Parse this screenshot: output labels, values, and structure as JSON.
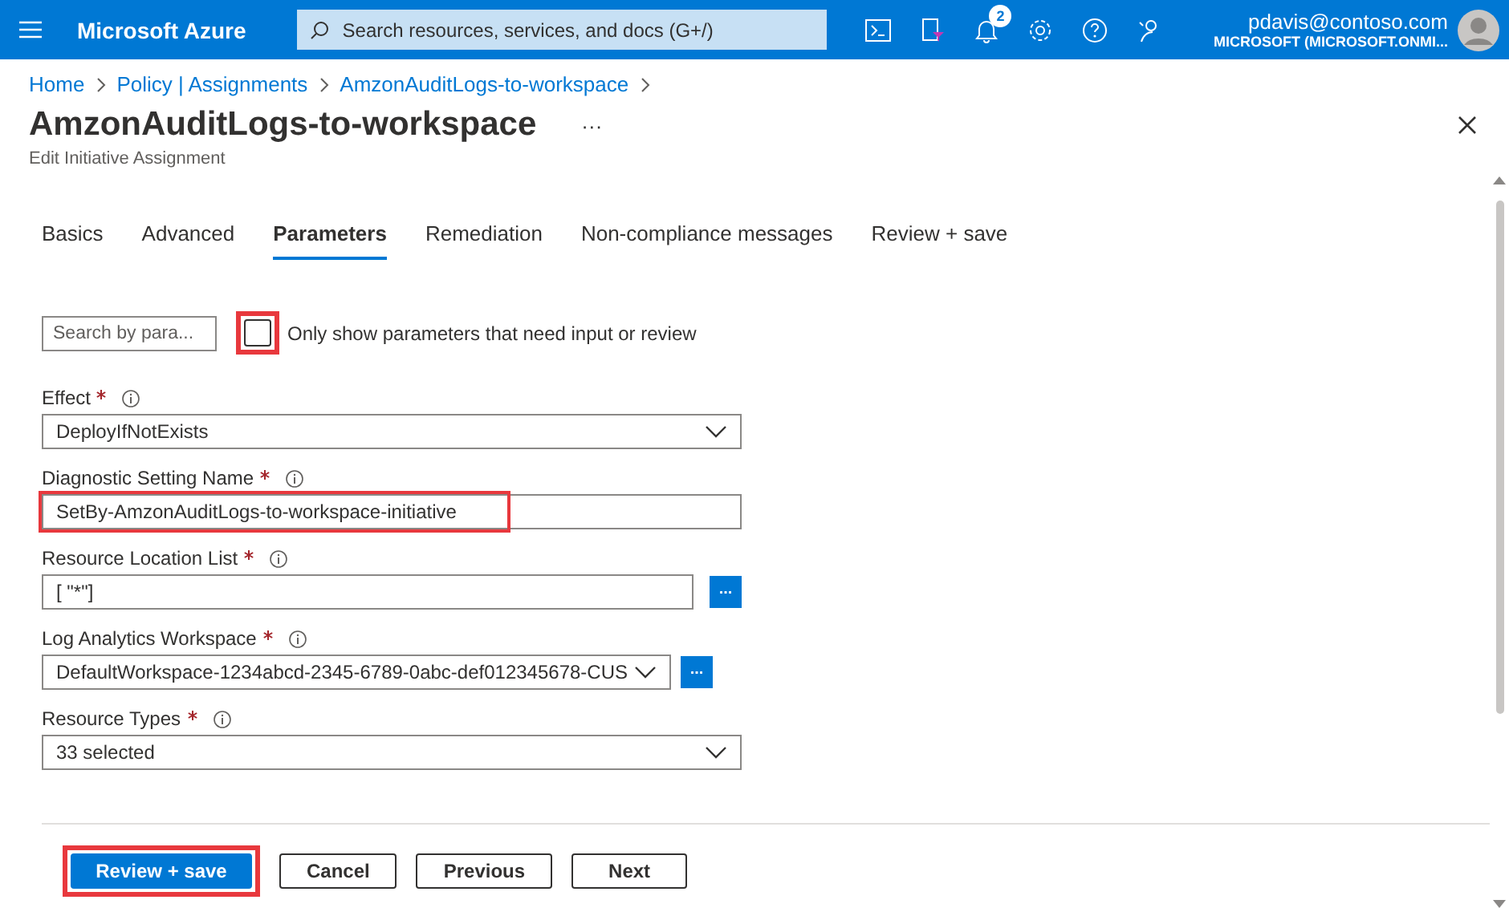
{
  "topbar": {
    "brand": "Microsoft Azure",
    "search": {
      "placeholder": "Search resources, services, and docs (G+/)"
    },
    "notifications_badge": "2",
    "user": {
      "email": "pdavis@contoso.com",
      "tenant": "MICROSOFT (MICROSOFT.ONMI..."
    }
  },
  "breadcrumb": [
    "Home",
    "Policy | Assignments",
    "AmzonAuditLogs-to-workspace"
  ],
  "page": {
    "title": "AmzonAuditLogs-to-workspace",
    "more": "···",
    "subtitle": "Edit Initiative Assignment"
  },
  "tabs": [
    {
      "label": "Basics",
      "selected": false
    },
    {
      "label": "Advanced",
      "selected": false
    },
    {
      "label": "Parameters",
      "selected": true
    },
    {
      "label": "Remediation",
      "selected": false
    },
    {
      "label": "Non-compliance messages",
      "selected": false
    },
    {
      "label": "Review + save",
      "selected": false
    }
  ],
  "filter": {
    "search": {
      "placeholder": "Search by para..."
    },
    "checkbox": {
      "label": "Only show parameters that need input or review",
      "checked": false,
      "highlighted": true
    }
  },
  "parameters": [
    {
      "kind": "dropdown",
      "label": "Effect",
      "required": true,
      "value": "DeployIfNotExists",
      "highlighted": false
    },
    {
      "kind": "text",
      "label": "Diagnostic Setting Name",
      "required": true,
      "value": "SetBy-AmzonAuditLogs-to-workspace-initiative",
      "highlighted": true
    },
    {
      "kind": "text_button",
      "label": "Resource Location List",
      "required": true,
      "value": "[  \"*\"]",
      "button": "...",
      "highlighted": false
    },
    {
      "kind": "dropdown_button",
      "label": "Log Analytics Workspace",
      "required": true,
      "value": "DefaultWorkspace-1234abcd-2345-6789-0abc-def012345678-CUS",
      "button": "...",
      "highlighted": false
    },
    {
      "kind": "dropdown",
      "label": "Resource Types",
      "required": true,
      "value": "33 selected",
      "highlighted": false
    }
  ],
  "footer": [
    {
      "label": "Review + save",
      "kind": "primary",
      "highlighted": true
    },
    {
      "label": "Cancel",
      "kind": "secondary",
      "highlighted": false
    },
    {
      "label": "Previous",
      "kind": "secondary",
      "highlighted": false
    },
    {
      "label": "Next",
      "kind": "secondary",
      "highlighted": false
    }
  ]
}
